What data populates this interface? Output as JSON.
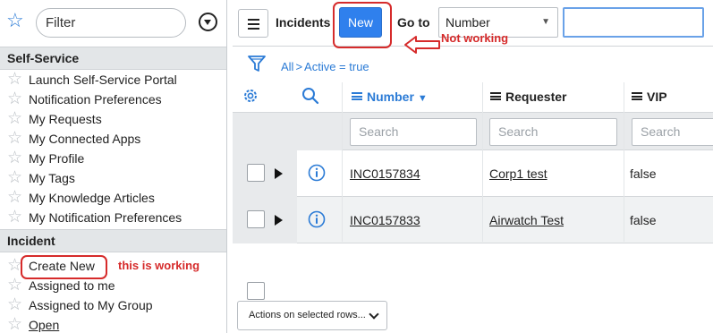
{
  "nav": {
    "filter_text": "Filter",
    "sections": [
      {
        "title": "Self-Service",
        "items": [
          "Launch Self-Service Portal",
          "Notification Preferences",
          "My Requests",
          "My Connected Apps",
          "My Profile",
          "My Tags",
          "My Knowledge Articles",
          "My Notification Preferences"
        ]
      },
      {
        "title": "Incident",
        "items": [
          "Create New",
          "Assigned to me",
          "Assigned to My Group",
          "Open"
        ]
      }
    ]
  },
  "toolbar": {
    "title": "Incidents",
    "new_label": "New",
    "goto_label": "Go to",
    "goto_field": "Number",
    "goto_value": ""
  },
  "breadcrumb": {
    "all": "All",
    "separator": ">",
    "condition": "Active = true"
  },
  "table": {
    "columns": [
      {
        "label": "Number",
        "sorted": "desc"
      },
      {
        "label": "Requester"
      },
      {
        "label": "VIP"
      }
    ],
    "search_placeholder": "Search",
    "rows": [
      {
        "number": "INC0157834",
        "requester": "Corp1 test",
        "vip": "false"
      },
      {
        "number": "INC0157833",
        "requester": "Airwatch Test",
        "vip": "false"
      }
    ],
    "actions_label": "Actions on selected rows..."
  },
  "annotations": {
    "not_working": "Not working",
    "working": "this is working"
  },
  "colors": {
    "accent": "#2b7bd6",
    "button": "#2f80ed",
    "annotation": "#d62b2b"
  }
}
